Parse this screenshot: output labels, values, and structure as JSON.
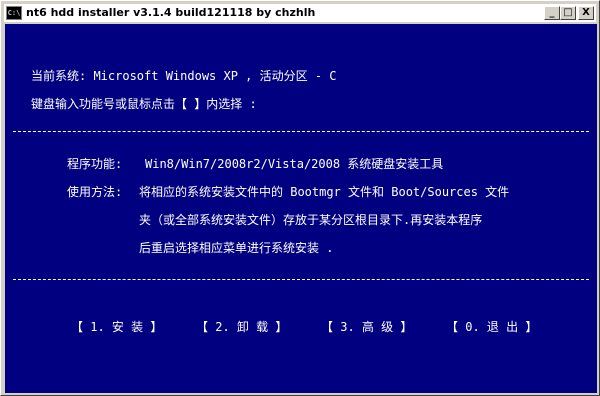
{
  "window": {
    "icon_text": "C:\\",
    "title": "nt6 hdd installer v3.1.4 build121118 by chzhlh",
    "controls": {
      "minimize": "_",
      "maximize": "□",
      "close": "X"
    }
  },
  "console": {
    "current_system": "当前系统: Microsoft Windows XP , 活动分区 - C",
    "prompt": "键盘输入功能号或鼠标点击【 】内选择 :",
    "function_label": "程序功能:",
    "function_value": "Win8/Win7/2008r2/Vista/2008 系统硬盘安装工具",
    "usage_label": "使用方法:",
    "usage_line1": "将相应的系统安装文件中的 Bootmgr 文件和 Boot/Sources 文件",
    "usage_line2": "夹（或全部系统安装文件）存放于某分区根目录下.再安装本程序",
    "usage_line3": "后重启选择相应菜单进行系统安装 .",
    "menu": [
      {
        "label": "【 1. 安 装 】"
      },
      {
        "label": "【 2. 卸 载 】"
      },
      {
        "label": "【 3. 高 级 】"
      },
      {
        "label": "【 0. 退 出 】"
      }
    ]
  }
}
